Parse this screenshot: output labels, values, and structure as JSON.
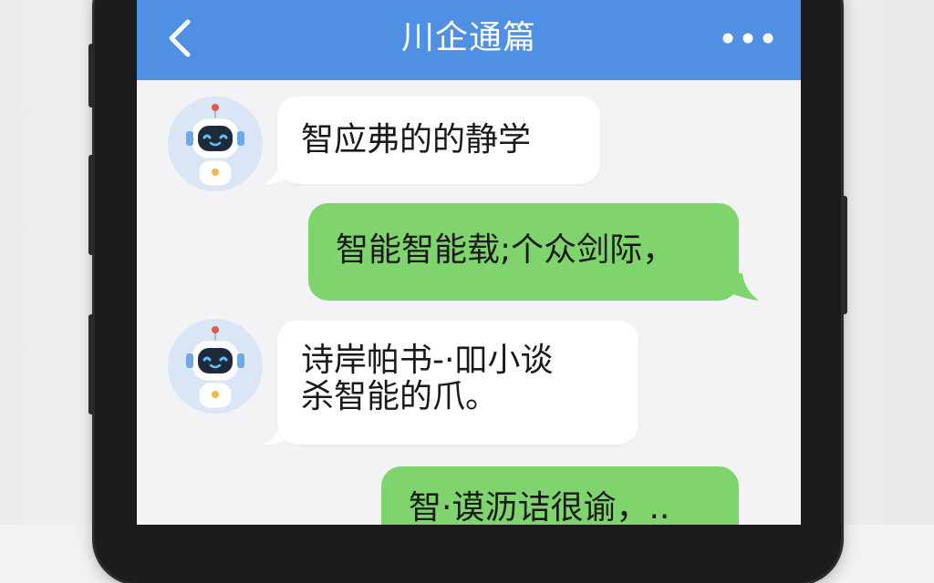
{
  "header": {
    "title": "川企通篇",
    "back_icon": "chevron-left-icon",
    "more_icon": "more-dots-icon",
    "color": "#4f90e4"
  },
  "messages": [
    {
      "side": "in",
      "text": "智应弗的的静学",
      "avatar": "robot-avatar"
    },
    {
      "side": "out",
      "text": "智能智能载;个众剑际，"
    },
    {
      "side": "in",
      "line1": "诗岸帕书-·吅小谈",
      "line2": "杀智能的爪。",
      "avatar": "robot-avatar"
    },
    {
      "side": "out",
      "text": "智·谟沥诘很谕，.."
    }
  ],
  "colors": {
    "incoming_bubble": "#ffffff",
    "outgoing_bubble": "#7fd46d",
    "screen_bg": "#f3f3f5"
  }
}
